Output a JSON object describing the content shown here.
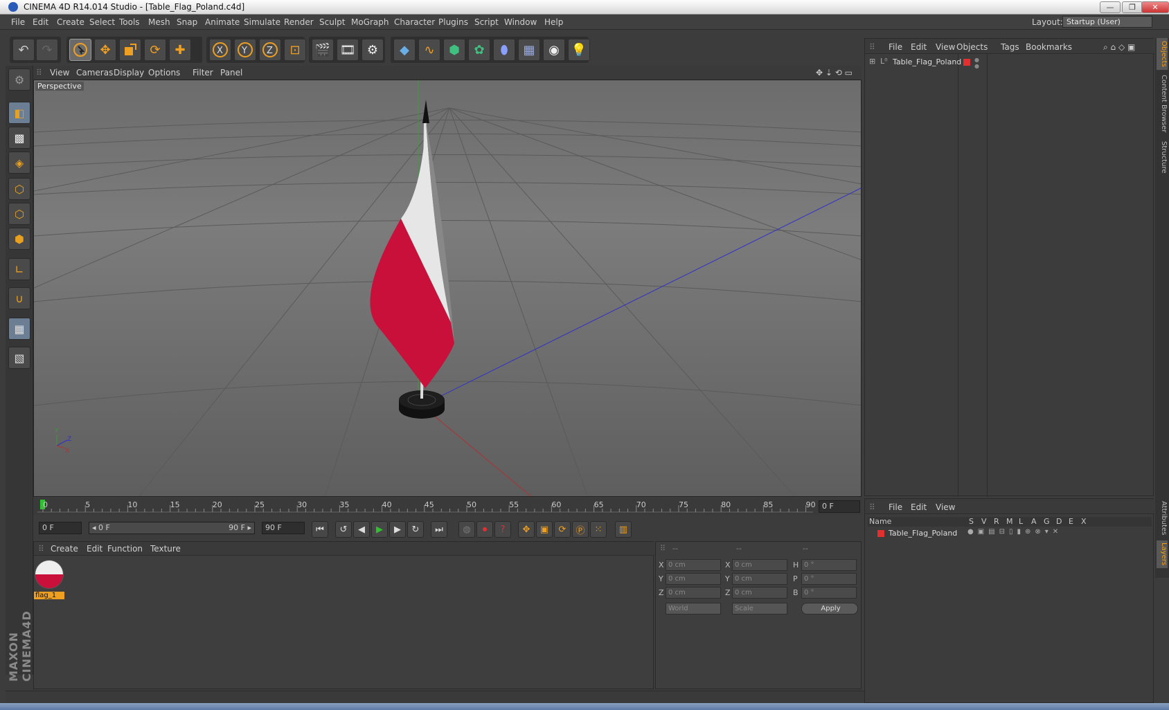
{
  "window": {
    "title": "CINEMA 4D R14.014 Studio - [Table_Flag_Poland.c4d]",
    "minimize": "—",
    "restore": "❐",
    "close": "✕"
  },
  "menu": [
    "File",
    "Edit",
    "Create",
    "Select",
    "Tools",
    "Mesh",
    "Snap",
    "Animate",
    "Simulate",
    "Render",
    "Sculpt",
    "MoGraph",
    "Character",
    "Plugins",
    "Script",
    "Window",
    "Help"
  ],
  "layout": {
    "label": "Layout:",
    "value": "Startup (User)"
  },
  "viewport": {
    "menu": [
      "View",
      "Cameras",
      "Display",
      "Options",
      "Filter",
      "Panel"
    ],
    "label": "Perspective"
  },
  "timeline": {
    "ticks": [
      "0",
      "5",
      "10",
      "15",
      "20",
      "25",
      "30",
      "35",
      "40",
      "45",
      "50",
      "55",
      "60",
      "65",
      "70",
      "75",
      "80",
      "85",
      "90"
    ],
    "end_frame": "0 F"
  },
  "transport": {
    "current": "0 F",
    "range_start": "◂ 0 F",
    "range_end": "90 F ▸",
    "max": "90 F"
  },
  "material": {
    "menu": [
      "Create",
      "Edit",
      "Function",
      "Texture"
    ],
    "items": [
      {
        "name": "flag_1"
      }
    ]
  },
  "coords": {
    "headers": [
      "--",
      "--",
      "--"
    ],
    "rows": [
      {
        "l1": "X",
        "v1": "0 cm",
        "l2": "X",
        "v2": "0 cm",
        "l3": "H",
        "v3": "0 °"
      },
      {
        "l1": "Y",
        "v1": "0 cm",
        "l2": "Y",
        "v2": "0 cm",
        "l3": "P",
        "v3": "0 °"
      },
      {
        "l1": "Z",
        "v1": "0 cm",
        "l2": "Z",
        "v2": "0 cm",
        "l3": "B",
        "v3": "0 °"
      }
    ],
    "world": "World",
    "scale": "Scale",
    "apply": "Apply"
  },
  "objects": {
    "menu": [
      "File",
      "Edit",
      "View",
      "Objects",
      "Tags",
      "Bookmarks"
    ],
    "items": [
      {
        "name": "Table_Flag_Poland",
        "color": "#e03030"
      }
    ]
  },
  "layers": {
    "menu": [
      "File",
      "Edit",
      "View"
    ],
    "cols": [
      "Name",
      "S",
      "V",
      "R",
      "M",
      "L",
      "A",
      "G",
      "D",
      "E",
      "X"
    ],
    "items": [
      {
        "name": "Table_Flag_Poland",
        "color": "#e03030"
      }
    ]
  },
  "right_tabs": [
    "Objects",
    "Content Browser",
    "Structure",
    "Attributes",
    "Layers"
  ],
  "branding": "MAXON CINEMA4D",
  "colors": {
    "accent": "#f0a020",
    "flag_red": "#c8103a",
    "flag_white": "#eeeeee"
  }
}
